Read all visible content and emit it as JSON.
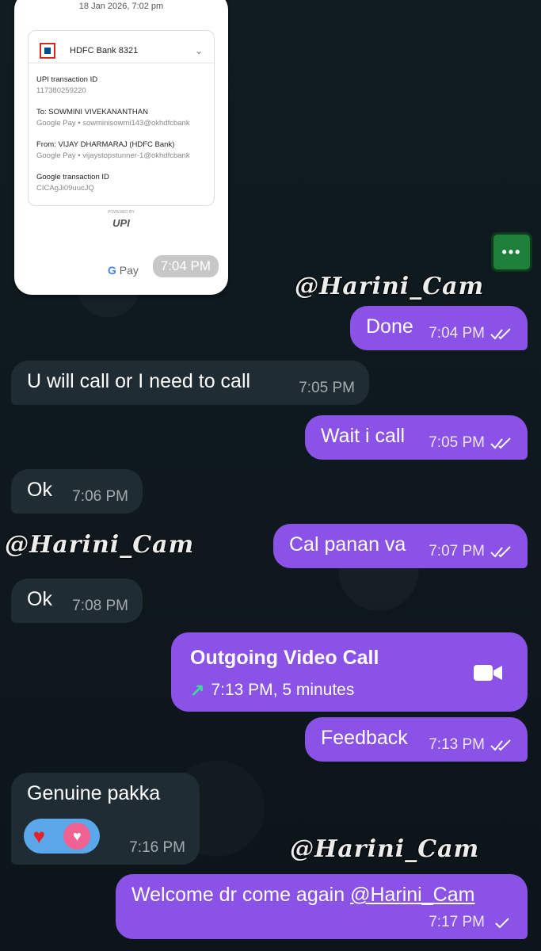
{
  "receipt": {
    "datetime": "18 Jan 2026, 7:02 pm",
    "bank": "HDFC Bank 8321",
    "fields": [
      {
        "label": "UPI transaction ID",
        "value": "117380259220"
      },
      {
        "label": "To: SOWMINI VIVEKANANTHAN",
        "value": "Google Pay • sowminisowmi143@okhdfcbank"
      },
      {
        "label": "From: VIJAY DHARMARAJ (HDFC Bank)",
        "value": "Google Pay • vijaystopstunner-1@okhdfcbank"
      },
      {
        "label": "Google transaction ID",
        "value": "CICAgJi09uucJQ"
      }
    ],
    "upi_powered": "POWERED BY",
    "upi_logo": "UPI",
    "gpay_label": "Pay",
    "time": "7:04 PM"
  },
  "watermark": "@Harini_Cam",
  "messages": [
    {
      "dir": "out",
      "text": "Done",
      "time": "7:04 PM"
    },
    {
      "dir": "in",
      "text": "U will call or I need to call",
      "time": "7:05 PM"
    },
    {
      "dir": "out",
      "text": "Wait i call",
      "time": "7:05 PM"
    },
    {
      "dir": "in",
      "text": "Ok",
      "time": "7:06 PM"
    },
    {
      "dir": "out",
      "text": "Cal panan va",
      "time": "7:07 PM"
    },
    {
      "dir": "in",
      "text": "Ok",
      "time": "7:08 PM"
    }
  ],
  "call": {
    "title": "Outgoing Video Call",
    "detail": "7:13 PM, 5 minutes"
  },
  "messages2": [
    {
      "dir": "out",
      "text": "Feedback",
      "time": "7:13 PM"
    },
    {
      "dir": "in",
      "text": "Genuine pakka",
      "time": "7:16 PM"
    }
  ],
  "last": {
    "text": "Welcome dr come again ",
    "mention": "@Harini_Cam",
    "time": "7:17 PM"
  },
  "icons": {
    "menu": "menu-dots-icon",
    "camera": "video-camera-icon",
    "arrow": "outgoing-arrow-icon",
    "ticks": "double-check-icon"
  }
}
